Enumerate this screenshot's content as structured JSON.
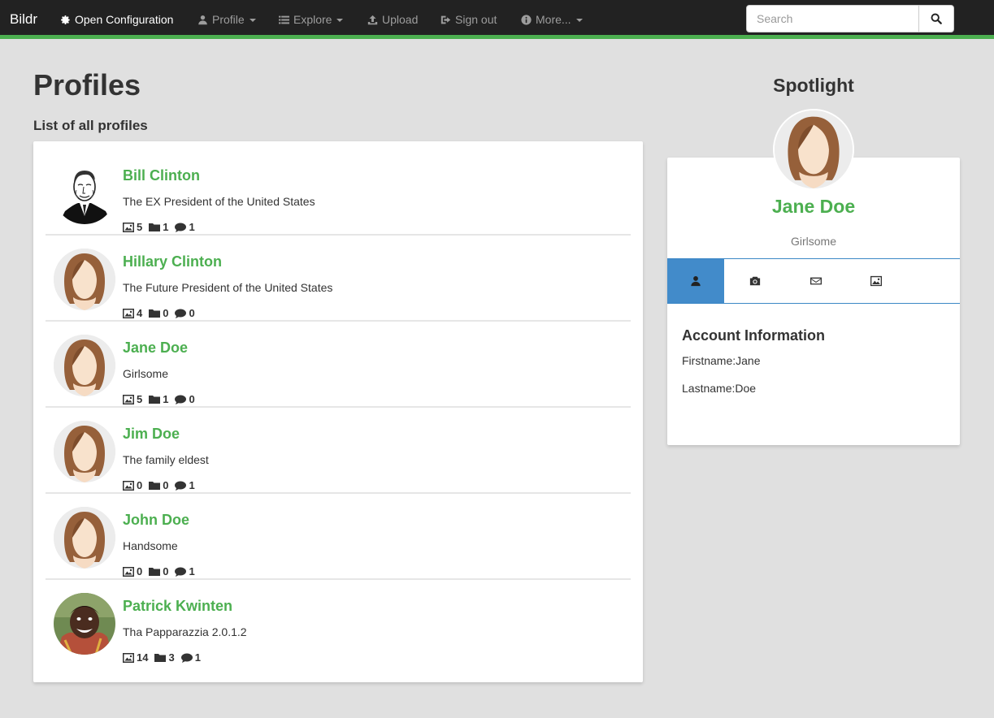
{
  "navbar": {
    "brand": "Bildr",
    "items": [
      {
        "label": "Open Configuration",
        "icon": "gear-icon"
      },
      {
        "label": "Profile",
        "icon": "user-icon",
        "dropdown": true
      },
      {
        "label": "Explore",
        "icon": "list-icon",
        "dropdown": true
      },
      {
        "label": "Upload",
        "icon": "upload-icon"
      },
      {
        "label": "Sign out",
        "icon": "sign-out-icon"
      },
      {
        "label": "More...",
        "icon": "info-icon",
        "dropdown": true
      }
    ],
    "search_placeholder": "Search",
    "accent": "#4caf50"
  },
  "main": {
    "title": "Profiles",
    "subtitle": "List of all profiles",
    "profiles": [
      {
        "name": "Bill Clinton",
        "description": "The EX President of the United States",
        "images": "5",
        "albums": "1",
        "comments": "1",
        "avatar": "sketch-portrait"
      },
      {
        "name": "Hillary Clinton",
        "description": "The Future President of the United States",
        "images": "4",
        "albums": "0",
        "comments": "0",
        "avatar": "default-female"
      },
      {
        "name": "Jane Doe",
        "description": "Girlsome",
        "images": "5",
        "albums": "1",
        "comments": "0",
        "avatar": "default-female"
      },
      {
        "name": "Jim Doe",
        "description": "The family eldest",
        "images": "0",
        "albums": "0",
        "comments": "1",
        "avatar": "default-female"
      },
      {
        "name": "John Doe",
        "description": "Handsome",
        "images": "0",
        "albums": "0",
        "comments": "1",
        "avatar": "default-female"
      },
      {
        "name": "Patrick Kwinten",
        "description": "Tha Papparazzia 2.0.1.2",
        "images": "14",
        "albums": "3",
        "comments": "1",
        "avatar": "child-photo"
      }
    ]
  },
  "spotlight": {
    "title": "Spotlight",
    "name": "Jane Doe",
    "description": "Girlsome",
    "tabs": [
      "user-icon",
      "camera-icon",
      "envelope-icon",
      "picture-icon"
    ],
    "active_tab": 0,
    "account_heading": "Account Information",
    "firstname_label": "Firstname:",
    "firstname": "Jane",
    "lastname_label": "Lastname:",
    "lastname": "Doe"
  }
}
